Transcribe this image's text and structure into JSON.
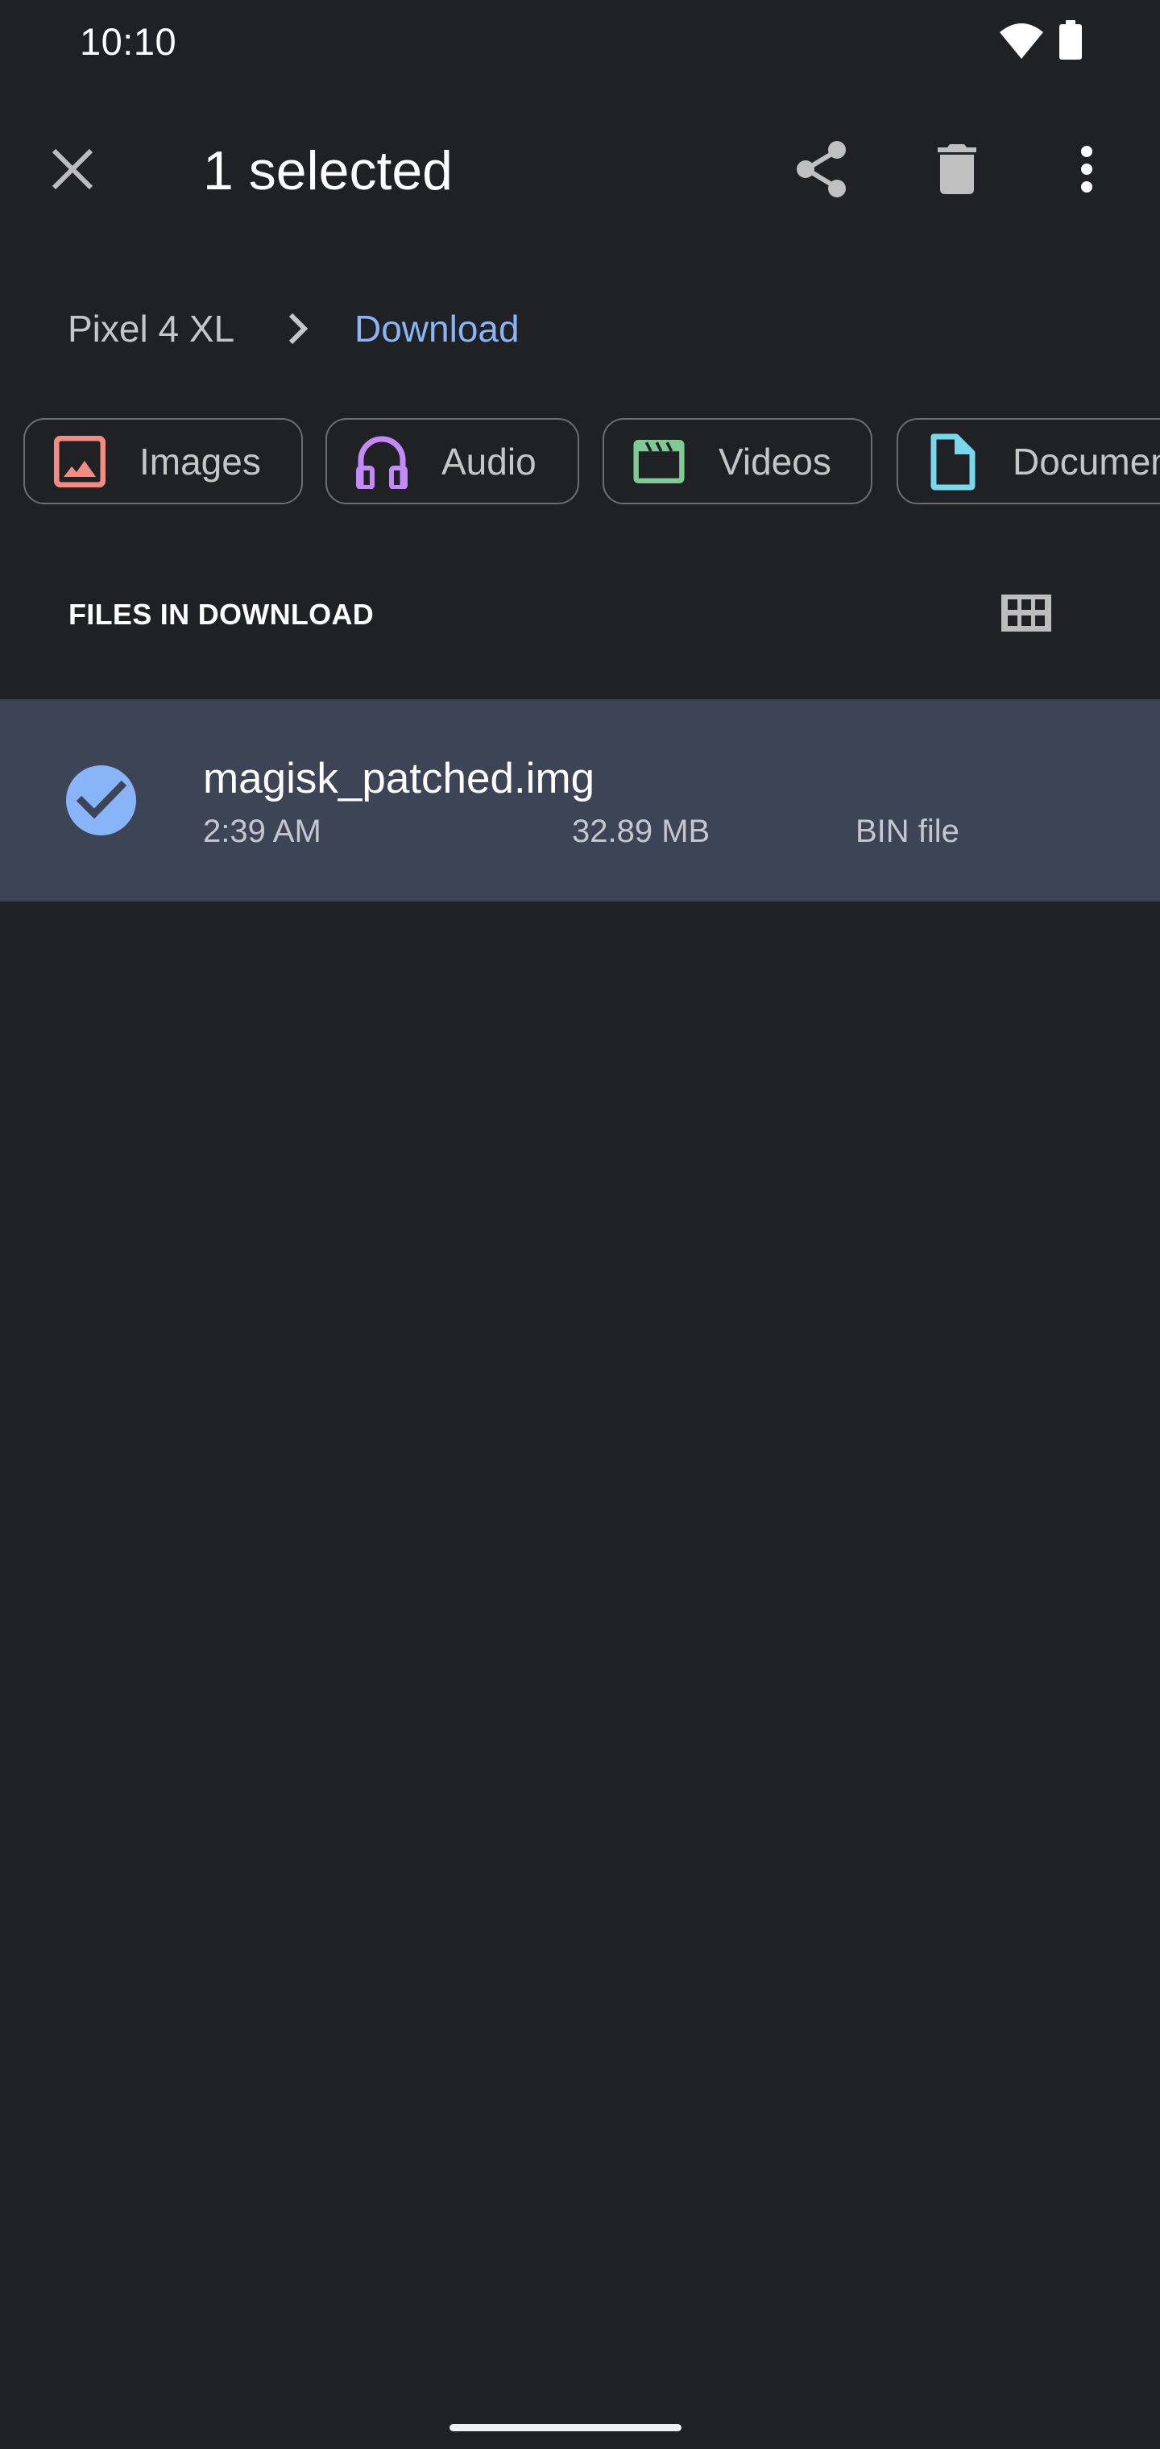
{
  "status_bar": {
    "time": "10:10",
    "icons": [
      "wifi-icon",
      "battery-icon"
    ]
  },
  "action_bar": {
    "title": "1 selected",
    "buttons": [
      {
        "name": "close",
        "icon": "close-icon"
      },
      {
        "name": "share",
        "icon": "share-icon"
      },
      {
        "name": "delete",
        "icon": "delete-icon"
      },
      {
        "name": "more",
        "icon": "more-vert-icon"
      }
    ]
  },
  "breadcrumb": {
    "items": [
      "Pixel 4 XL",
      "Download"
    ],
    "separator_icon": "chevron-right-icon"
  },
  "filters": {
    "chips": [
      {
        "label": "Images",
        "icon": "image-icon",
        "color": "#f28b82"
      },
      {
        "label": "Audio",
        "icon": "headphones-icon",
        "color": "#c58af9"
      },
      {
        "label": "Videos",
        "icon": "movie-clapper-icon",
        "color": "#81c995"
      },
      {
        "label": "Documents",
        "icon": "document-icon",
        "color": "#78d9ec"
      }
    ]
  },
  "section": {
    "title": "FILES IN DOWNLOAD",
    "view_toggle_icon": "grid-view-icon"
  },
  "files": [
    {
      "name": "magisk_patched.img",
      "time": "2:39 AM",
      "size": "32.89 MB",
      "type": "BIN file",
      "selected": true
    }
  ],
  "colors": {
    "background": "#202124",
    "accent": "#8ab4f8",
    "selected_row": "#3c4455",
    "chip_border": "#6b6e73"
  }
}
